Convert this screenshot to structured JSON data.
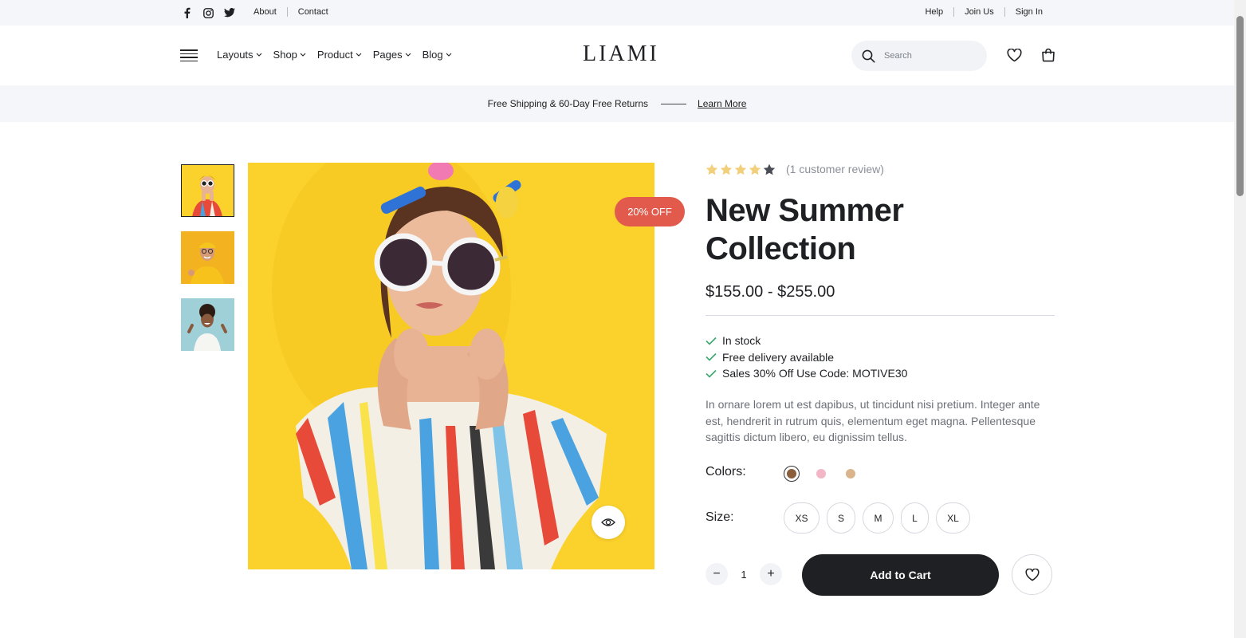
{
  "topbar": {
    "social": [
      {
        "icon": "facebook-icon",
        "glyph": "f"
      },
      {
        "icon": "instagram-icon",
        "glyph": ""
      },
      {
        "icon": "twitter-icon",
        "glyph": ""
      }
    ],
    "links": [
      "About",
      "Contact"
    ],
    "right_links": [
      "Help",
      "Join Us",
      "Sign In"
    ]
  },
  "header": {
    "logo": "LIAMI",
    "nav": [
      "Layouts",
      "Shop",
      "Product",
      "Pages",
      "Blog"
    ],
    "search_placeholder": "Search",
    "icons": [
      "search-icon",
      "heart-icon",
      "shopping-bag-icon",
      "menu-icon"
    ]
  },
  "promo": {
    "text": "Free Shipping & 60-Day Free Returns",
    "link": "Learn More"
  },
  "gallery": {
    "badge": "20% OFF",
    "active_thumb": 0
  },
  "product": {
    "rating": 4,
    "rating_max": 5,
    "review_text": "(1 customer review)",
    "title_line1": "New Summer",
    "title_line2": "Collection",
    "price": "$155.00 - $255.00",
    "features": [
      "In stock",
      "Free delivery available",
      "Sales 30% Off Use Code: MOTIVE30"
    ],
    "description": "In ornare lorem ut est dapibus, ut tincidunt nisi pretium. Integer ante est, hendrerit in rutrum quis, elementum eget magna. Pellentesque sagittis dictum libero, eu dignissim tellus.",
    "colors_label": "Colors:",
    "colors": [
      "#8b5e3c",
      "#f3b6c6",
      "#d9b48c"
    ],
    "selected_color": 0,
    "size_label": "Size:",
    "sizes": [
      "XS",
      "S",
      "M",
      "L",
      "XL"
    ],
    "quantity": "1",
    "qty_minus": "−",
    "qty_plus": "+",
    "add_to_cart": "Add to Cart"
  },
  "colors": {
    "accent_badge": "#e15a4c",
    "image_bg": "#fbd12c",
    "check": "#3aa76d",
    "star": "#f2cf7a",
    "star_empty": "#4a4d55",
    "dark": "#1f2023"
  }
}
